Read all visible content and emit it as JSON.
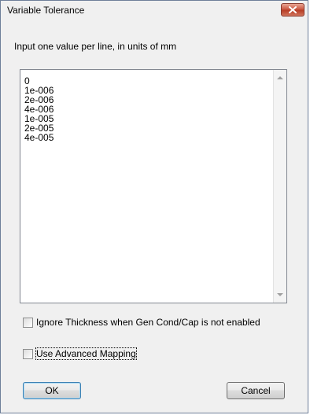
{
  "window": {
    "title": "Variable Tolerance",
    "close_icon": "close-icon"
  },
  "instruction": "Input one value per line, in units of mm",
  "tolerance_values": [
    "0",
    "1e-006",
    "2e-006",
    "4e-006",
    "1e-005",
    "2e-005",
    "4e-005"
  ],
  "options": {
    "ignore_thickness_label": "Ignore Thickness when Gen Cond/Cap is not enabled",
    "ignore_thickness_checked": false,
    "advanced_mapping_label": "Use Advanced Mapping",
    "advanced_mapping_checked": false
  },
  "buttons": {
    "ok_label": "OK",
    "cancel_label": "Cancel"
  }
}
